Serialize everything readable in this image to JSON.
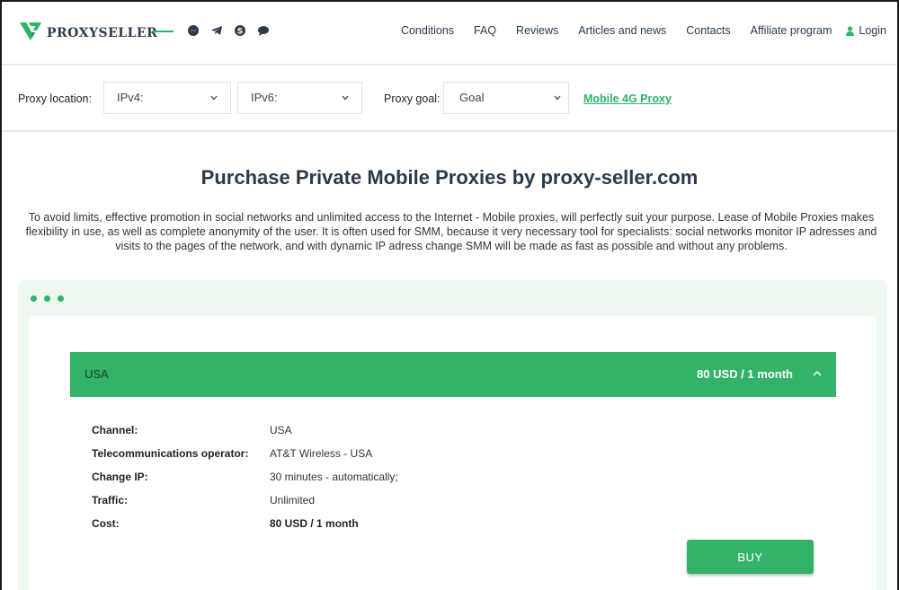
{
  "header": {
    "logo_text": "PROXYSELLER",
    "social_icons": [
      "messenger-icon",
      "telegram-icon",
      "skype-icon",
      "chat-icon"
    ],
    "nav": [
      "Conditions",
      "FAQ",
      "Reviews",
      "Articles and news",
      "Contacts",
      "Affiliate program"
    ],
    "login_label": "Login"
  },
  "filter": {
    "location_label": "Proxy location:",
    "ipv4_value": "IPv4:",
    "ipv6_value": "IPv6:",
    "goal_label": "Proxy goal:",
    "goal_value": "Goal",
    "mobile_link": "Mobile 4G Proxy"
  },
  "main": {
    "title": "Purchase Private Mobile Proxies by proxy-seller.com",
    "description": "To avoid limits, effective promotion in social networks and unlimited access to the Internet - Mobile proxies, will perfectly suit your purpose. Lease of Mobile Proxies makes flexibility in use, as well as complete anonymity of the user. It is often used for SMM, because it very necessary tool for specialists: social networks monitor IP adresses and visits to the pages of the network, and with dynamic IP adress change SMM will be made as fast as possible and without any problems."
  },
  "offer": {
    "country": "USA",
    "price": "80 USD / 1 month",
    "details": [
      {
        "label": "Channel:",
        "value": "USA"
      },
      {
        "label": "Telecommunications operator:",
        "value": "AT&T Wireless - USA"
      },
      {
        "label": "Change IP:",
        "value": "30 minutes - automatically;"
      },
      {
        "label": "Traffic:",
        "value": "Unlimited"
      },
      {
        "label": "Cost:",
        "value": "80 USD / 1 month"
      }
    ],
    "buy_label": "BUY"
  },
  "colors": {
    "accent": "#33b36a",
    "text_dark": "#2b3a4a",
    "panel_bg": "#eef8f1"
  }
}
